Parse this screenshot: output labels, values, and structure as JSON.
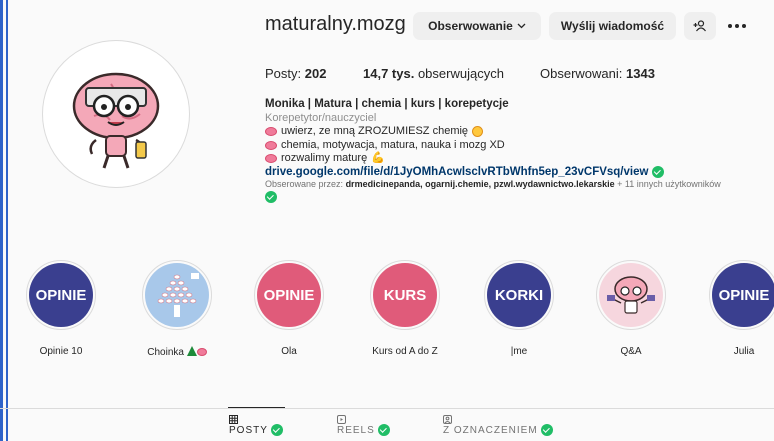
{
  "profile": {
    "username": "maturalny.mozg",
    "follow_button": "Obserwowanie",
    "message_button": "Wyślij wiadomość",
    "stats": {
      "posts_label": "Posty:",
      "posts_value": "202",
      "followers_value": "14,7 tys.",
      "followers_label": "obserwujących",
      "following_label": "Obserwowani:",
      "following_value": "1343"
    },
    "bio": {
      "name": "Monika | Matura | chemia | kurs | korepetycje",
      "category": "Korepetytor/nauczyciel",
      "line1": "uwierz, ze mną ZROZUMIESZ chemię",
      "line2": "chemia, motywacja, matura, nauka i mozg XD",
      "line3": "rozwalimy maturę",
      "link": "drive.google.com/file/d/1JyOMhAcwlsclvRTbWhfn5ep_23vCFVsq/view",
      "followed_by_prefix": "Obserowane przez:",
      "followed_by_names": "drmedicinepanda, ogarnij.chemie, pzwl.wydawnictwo.lekarskie",
      "followed_by_suffix": "+ 11 innych użytkowników"
    }
  },
  "highlights": [
    {
      "label": "Opinie 10",
      "cover_text": "OPINIE",
      "color": "#3a3f8f"
    },
    {
      "label": "Choinka",
      "cover_text": "",
      "color": "#a8c8ea"
    },
    {
      "label": "Ola",
      "cover_text": "OPINIE",
      "color": "#e05b7a"
    },
    {
      "label": "Kurs od A do Z",
      "cover_text": "KURS",
      "color": "#e05b7a"
    },
    {
      "label": "|me",
      "cover_text": "KORKI",
      "color": "#3a3f8f"
    },
    {
      "label": "Q&A",
      "cover_text": "",
      "color": "#f6d6de"
    },
    {
      "label": "Julia",
      "cover_text": "OPINIE",
      "color": "#3a3f8f"
    }
  ],
  "tabs": [
    {
      "label": "POSTY",
      "active": true
    },
    {
      "label": "REELS",
      "active": false
    },
    {
      "label": "Z OZNACZENIEM",
      "active": false
    }
  ],
  "colors": {
    "accent_blue": "#3a3f8f",
    "accent_pink": "#e05b7a",
    "verified_green": "#20bd66",
    "link": "#00376b"
  }
}
